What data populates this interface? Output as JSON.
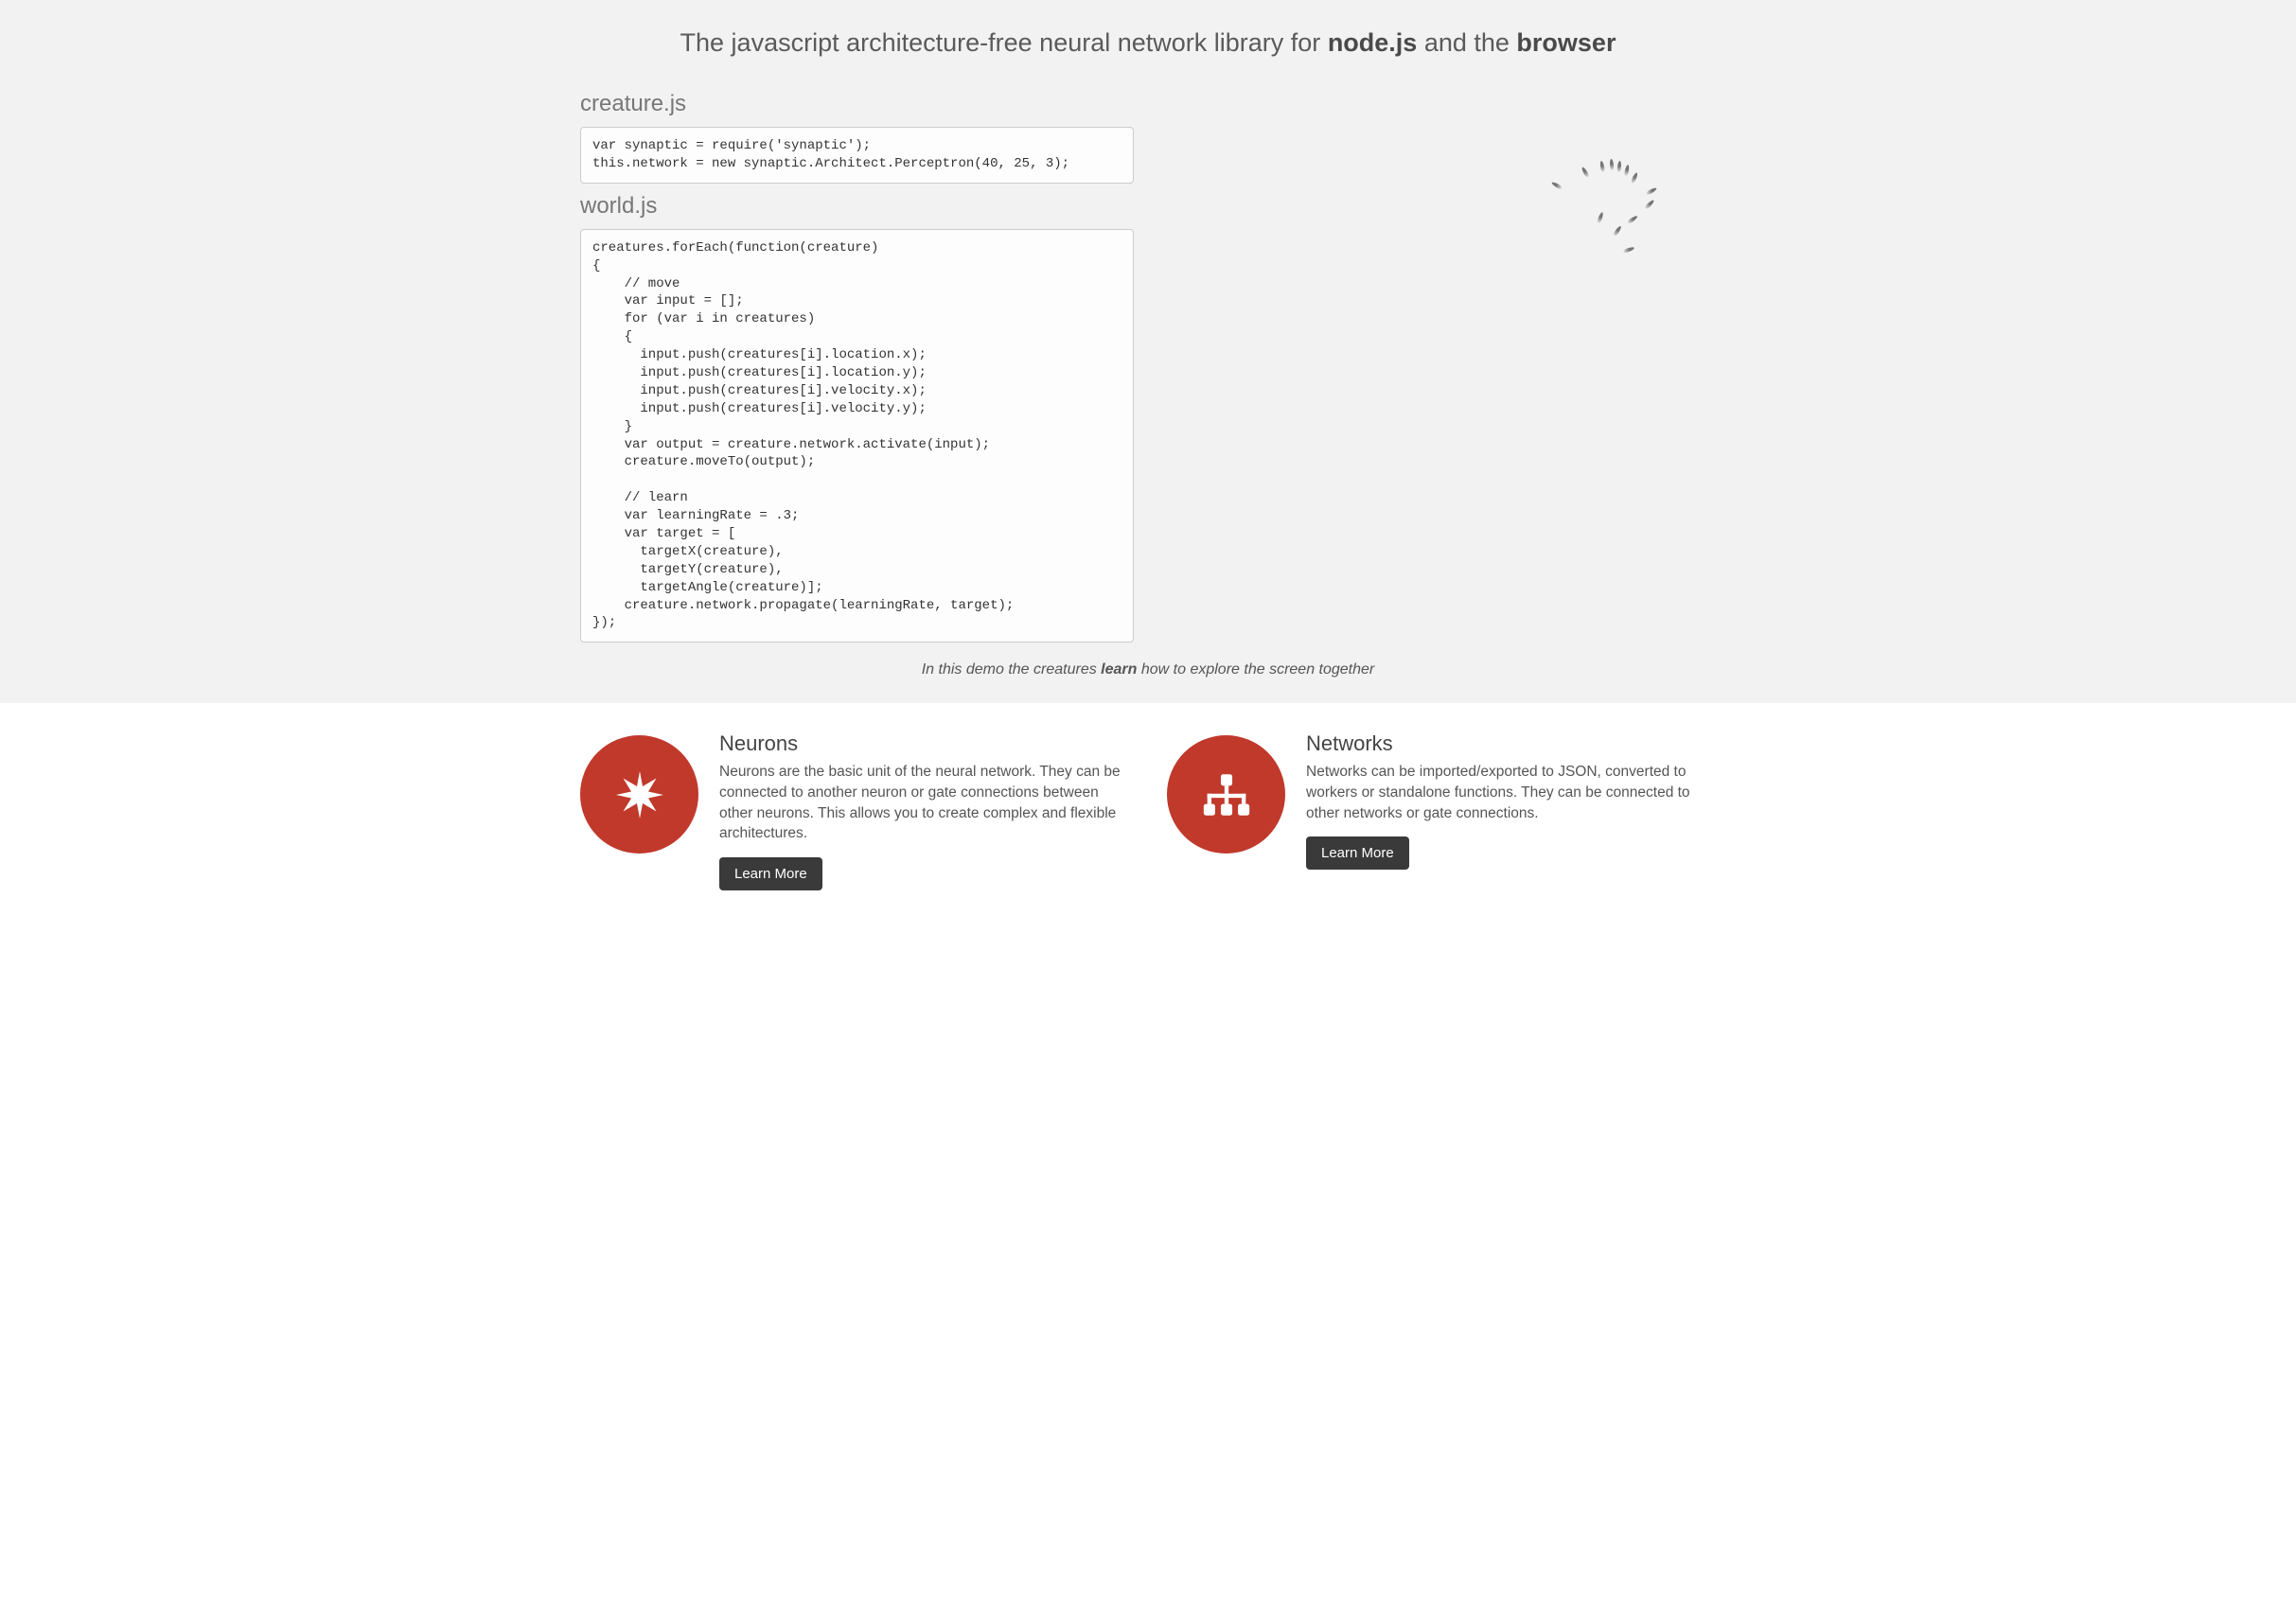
{
  "tagline": {
    "pre": "The javascript architecture-free neural network library for ",
    "bold1": "node.js",
    "mid": " and the ",
    "bold2": "browser"
  },
  "code1": {
    "label": "creature.js",
    "content": "var synaptic = require('synaptic');\nthis.network = new synaptic.Architect.Perceptron(40, 25, 3);"
  },
  "code2": {
    "label": "world.js",
    "content": "creatures.forEach(function(creature)\n{\n    // move\n    var input = [];\n    for (var i in creatures)\n    {\n      input.push(creatures[i].location.x);\n      input.push(creatures[i].location.y);\n      input.push(creatures[i].velocity.x);\n      input.push(creatures[i].velocity.y);\n    }\n    var output = creature.network.activate(input);\n    creature.moveTo(output);\n\n    // learn\n    var learningRate = .3;\n    var target = [\n      targetX(creature),\n      targetY(creature),\n      targetAngle(creature)];\n    creature.network.propagate(learningRate, target);\n});"
  },
  "demoCaption": {
    "pre": "In this demo the creatures ",
    "bold": "learn",
    "post": " how to explore the screen together"
  },
  "features": {
    "neurons": {
      "title": "Neurons",
      "desc": "Neurons are the basic unit of the neural network. They can be connected to another neuron or gate connections between other neurons. This allows you to create complex and flexible architectures.",
      "button": "Learn More"
    },
    "networks": {
      "title": "Networks",
      "desc": "Networks can be imported/exported to JSON, converted to workers or standalone functions. They can be connected to other networks or gate connections.",
      "button": "Learn More"
    }
  }
}
